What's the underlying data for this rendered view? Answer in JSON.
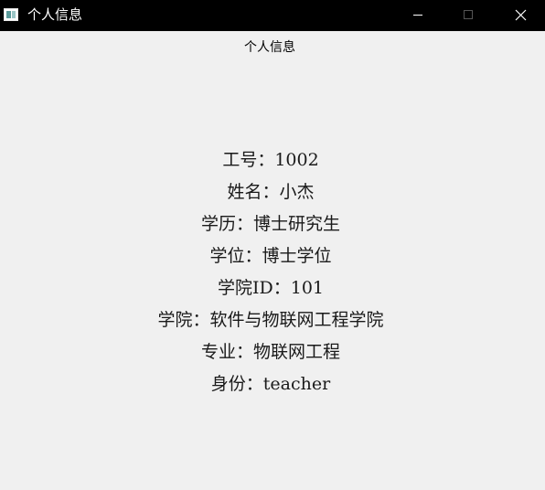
{
  "window": {
    "title": "个人信息",
    "controls": {
      "minimize": "minimize-icon",
      "maximize": "maximize-icon",
      "close": "close-icon"
    }
  },
  "header": {
    "title": "个人信息"
  },
  "profile": {
    "rows": [
      {
        "label": "工号：",
        "value": "1002"
      },
      {
        "label": "姓名：",
        "value": "小杰"
      },
      {
        "label": "学历：",
        "value": "博士研究生"
      },
      {
        "label": "学位：",
        "value": "博士学位"
      },
      {
        "label": "学院ID：",
        "value": "101"
      },
      {
        "label": "学院：",
        "value": "软件与物联网工程学院"
      },
      {
        "label": "专业：",
        "value": "物联网工程"
      },
      {
        "label": "身份：",
        "value": "teacher"
      }
    ]
  },
  "colors": {
    "titlebar_bg": "#000000",
    "window_bg": "#f0f0f0",
    "text": "#1a1a1a"
  }
}
